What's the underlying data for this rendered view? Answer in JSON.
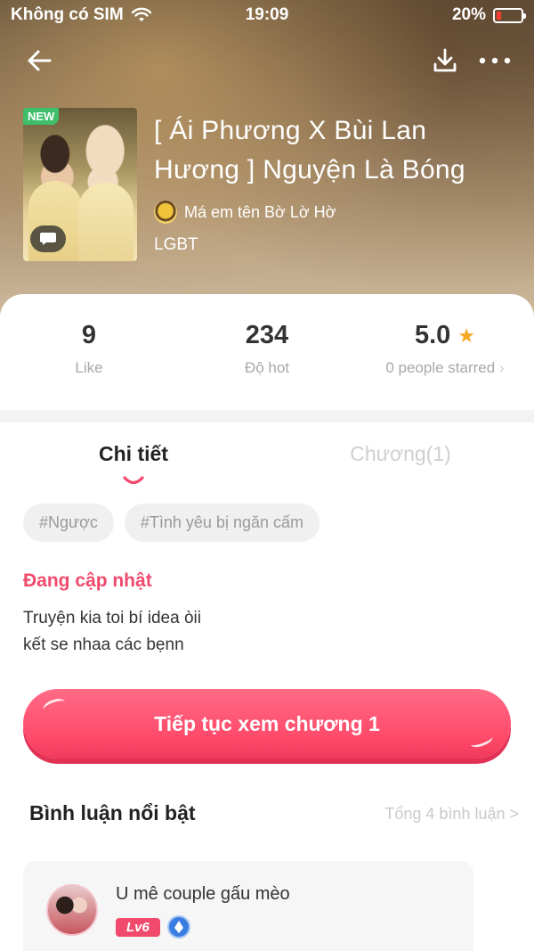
{
  "status_bar": {
    "carrier": "Không có SIM",
    "time": "19:09",
    "battery": "20%",
    "battery_level": 0.2
  },
  "story": {
    "badge_new": "NEW",
    "title": "[ Ái Phương X Bùi Lan Hương ] Nguyện Là Bóng",
    "author": "Má em tên Bờ Lờ Hờ",
    "category": "LGBT"
  },
  "stats": [
    {
      "value": "9",
      "label": "Like"
    },
    {
      "value": "234",
      "label": "Độ hot"
    },
    {
      "value": "5.0",
      "label": "0 people starred"
    }
  ],
  "tabs": [
    {
      "label": "Chi tiết",
      "active": true
    },
    {
      "label": "Chương(1)",
      "active": false
    }
  ],
  "tags": [
    "#Ngược",
    "#Tình yêu bị ngăn cấm"
  ],
  "detail": {
    "status": "Đang cập nhật",
    "description_line1": "Truyện kia toi bí idea òii",
    "description_line2": "kết se nhaa các bẹnn"
  },
  "cta": {
    "label": "Tiếp tục xem chương 1"
  },
  "comments": {
    "title": "Bình luận nổi bật",
    "total": "Tổng 4 bình luận >",
    "items": [
      {
        "name": "U mê couple gấu mèo",
        "level": "Lv6"
      }
    ]
  },
  "colors": {
    "accent": "#f04a6d",
    "cta": "#ff4a6a",
    "new_badge": "#3fbf6a",
    "star": "#f5a623"
  }
}
